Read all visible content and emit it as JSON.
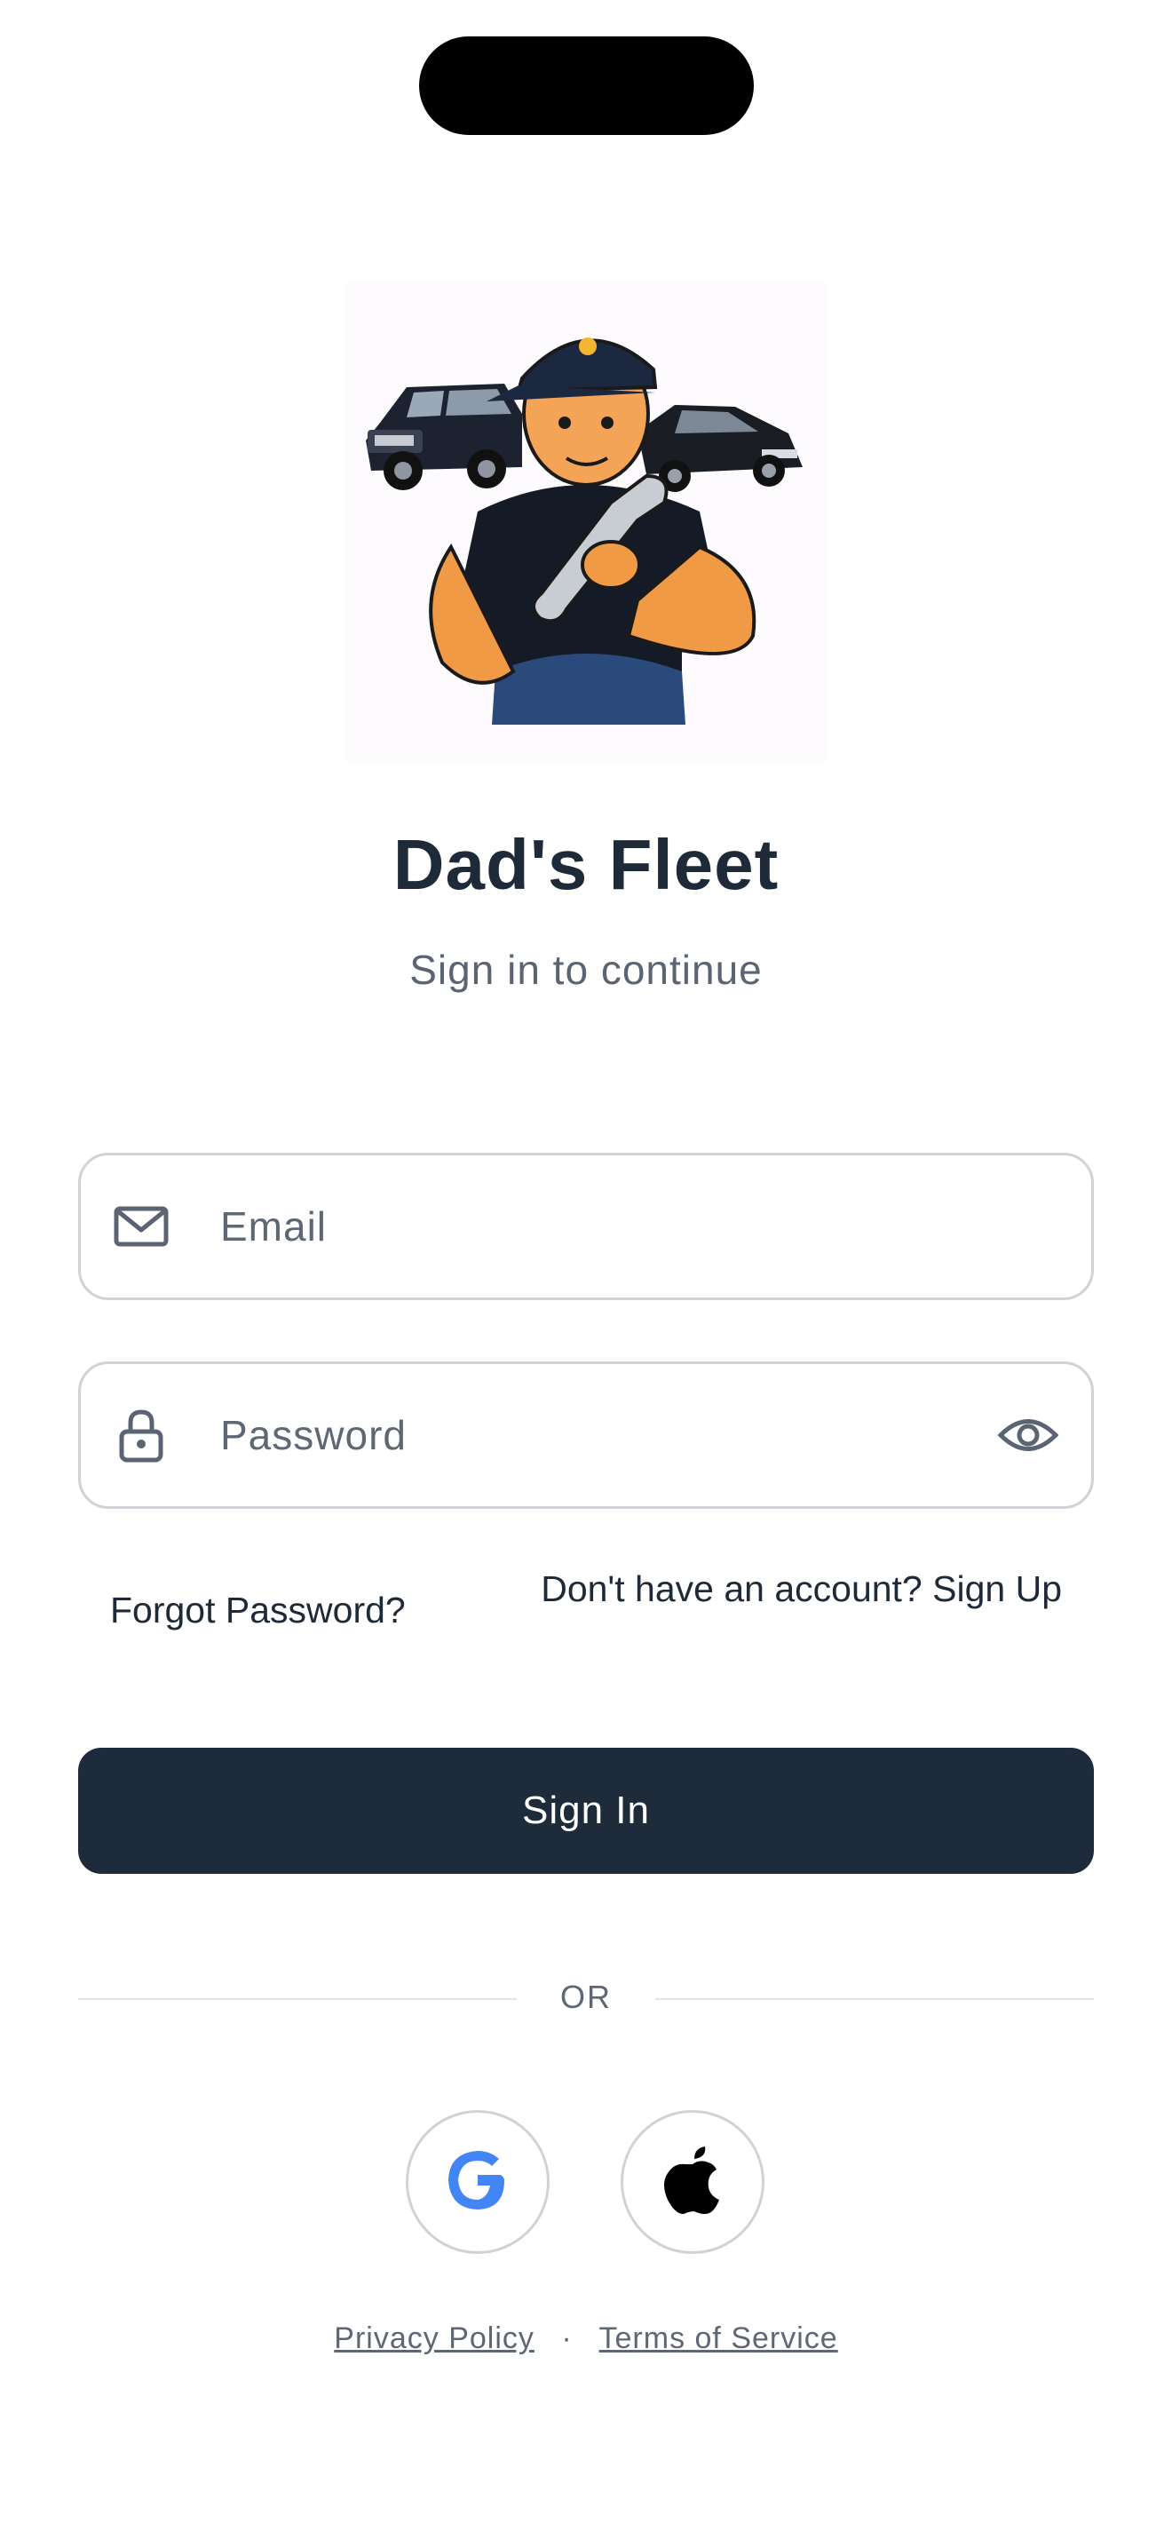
{
  "app": {
    "title": "Dad's Fleet",
    "subtitle": "Sign in to continue"
  },
  "logo": {
    "icon": "mechanic-mascot-with-cars-logo"
  },
  "form": {
    "email": {
      "placeholder": "Email",
      "value": "",
      "icon": "mail-icon"
    },
    "password": {
      "placeholder": "Password",
      "value": "",
      "icon": "lock-icon",
      "toggle_icon": "eye-icon"
    }
  },
  "links": {
    "forgot_password": "Forgot Password?",
    "signup": "Don't have an account? Sign Up"
  },
  "buttons": {
    "sign_in": "Sign In"
  },
  "divider": {
    "label": "OR"
  },
  "social": [
    {
      "provider": "Google",
      "icon": "google-icon"
    },
    {
      "provider": "Apple",
      "icon": "apple-icon"
    }
  ],
  "footer": {
    "privacy": "Privacy Policy",
    "separator": "·",
    "terms": "Terms of Service"
  },
  "colors": {
    "primary": "#1e2b3a",
    "text": "#1e2a38",
    "muted": "#5f6774",
    "border": "#cfd3d8",
    "google_blue": "#4285f4"
  }
}
